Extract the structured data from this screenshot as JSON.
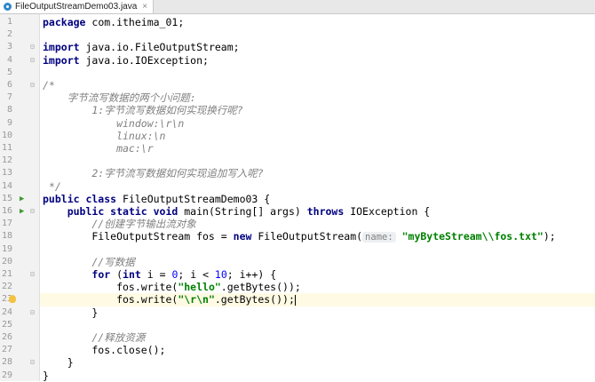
{
  "tab": {
    "title": "FileOutputStreamDemo03.java",
    "close": "×"
  },
  "lines": {
    "l1": {
      "n": "1",
      "a": "package",
      "b": " com.itheima_01;"
    },
    "l2": {
      "n": "2"
    },
    "l3": {
      "n": "3",
      "a": "import",
      "b": " java.io.FileOutputStream;"
    },
    "l4": {
      "n": "4",
      "a": "import",
      "b": " java.io.IOException;"
    },
    "l5": {
      "n": "5"
    },
    "l6": {
      "n": "6",
      "c": "/*"
    },
    "l7": {
      "n": "7",
      "c": "    字节流写数据的两个小问题:"
    },
    "l8": {
      "n": "8",
      "c": "        1:字节流写数据如何实现换行呢?"
    },
    "l9": {
      "n": "9",
      "c": "            window:\\r\\n"
    },
    "l10": {
      "n": "10",
      "c": "            linux:\\n"
    },
    "l11": {
      "n": "11",
      "c": "            mac:\\r"
    },
    "l12": {
      "n": "12"
    },
    "l13": {
      "n": "13",
      "c": "        2:字节流写数据如何实现追加写入呢?"
    },
    "l14": {
      "n": "14",
      "c": " */"
    },
    "l15": {
      "n": "15",
      "a": "public class",
      "b": " FileOutputStreamDemo03 {"
    },
    "l16": {
      "n": "16",
      "i": "    ",
      "a": "public static void",
      "b": " main(String[] args) ",
      "a2": "throws",
      "b2": " IOException {"
    },
    "l17": {
      "n": "17",
      "c": "        //创建字节输出流对象"
    },
    "l18": {
      "n": "18",
      "b": "        FileOutputStream fos = ",
      "a": "new",
      "b2": " FileOutputStream(",
      "hint": "name:",
      "s": "\"myByteStream\\\\fos.txt\"",
      "b3": ");"
    },
    "l19": {
      "n": "19"
    },
    "l20": {
      "n": "20",
      "c": "        //写数据"
    },
    "l21": {
      "n": "21",
      "i": "        ",
      "a": "for",
      "b": " (",
      "a2": "int",
      "b2": " i = ",
      "n0": "0",
      "b3": "; i < ",
      "n1": "10",
      "b4": "; i++) {"
    },
    "l22": {
      "n": "22",
      "b": "            fos.write(",
      "s": "\"hello\"",
      "b2": ".getBytes());"
    },
    "l23": {
      "n": "23",
      "b": "            fos.write(",
      "s": "\"\\r\\n\"",
      "b2": ".getBytes());"
    },
    "l24": {
      "n": "24",
      "b": "        }"
    },
    "l25": {
      "n": "25"
    },
    "l26": {
      "n": "26",
      "c": "        //释放资源"
    },
    "l27": {
      "n": "27",
      "b": "        fos.close();"
    },
    "l28": {
      "n": "28",
      "b": "    }"
    },
    "l29": {
      "n": "29",
      "b": "}"
    }
  }
}
